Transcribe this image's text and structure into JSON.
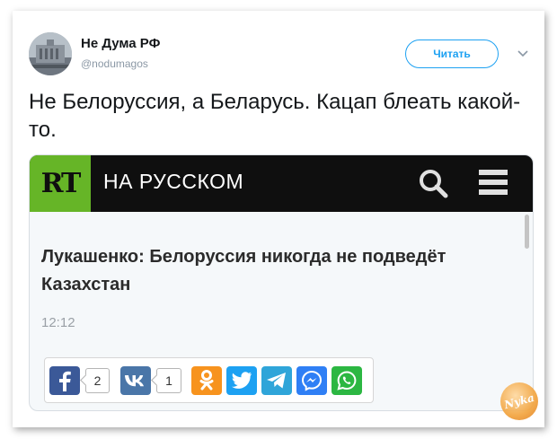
{
  "tweet": {
    "author_name": "Не Дума РФ",
    "author_handle": "@nodumagos",
    "follow_label": "Читать",
    "text": "Не Белоруссия, а Беларусь. Кацап блеать какой-то."
  },
  "embed": {
    "brand_logo": "RT",
    "brand_title": "НА РУССКОМ",
    "headline": "Лукашенко: Белоруссия никогда не подведёт Казахстан",
    "time": "12:12",
    "share": {
      "facebook_count": "2",
      "vk_count": "1",
      "icons": [
        "facebook-icon",
        "vk-icon",
        "odnoklassniki-icon",
        "twitter-icon",
        "telegram-icon",
        "messenger-icon",
        "whatsapp-icon"
      ]
    }
  },
  "watermark": "Nyka",
  "colors": {
    "twitter_blue": "#1da1f2",
    "rt_green": "#66b527",
    "facebook": "#3b5998",
    "vk": "#4a76a8",
    "odnoklassniki": "#f7931e",
    "twitter_share": "#1da1f2",
    "telegram": "#2fa5d9",
    "messenger": "#2f7ff5",
    "whatsapp": "#2cb742"
  }
}
